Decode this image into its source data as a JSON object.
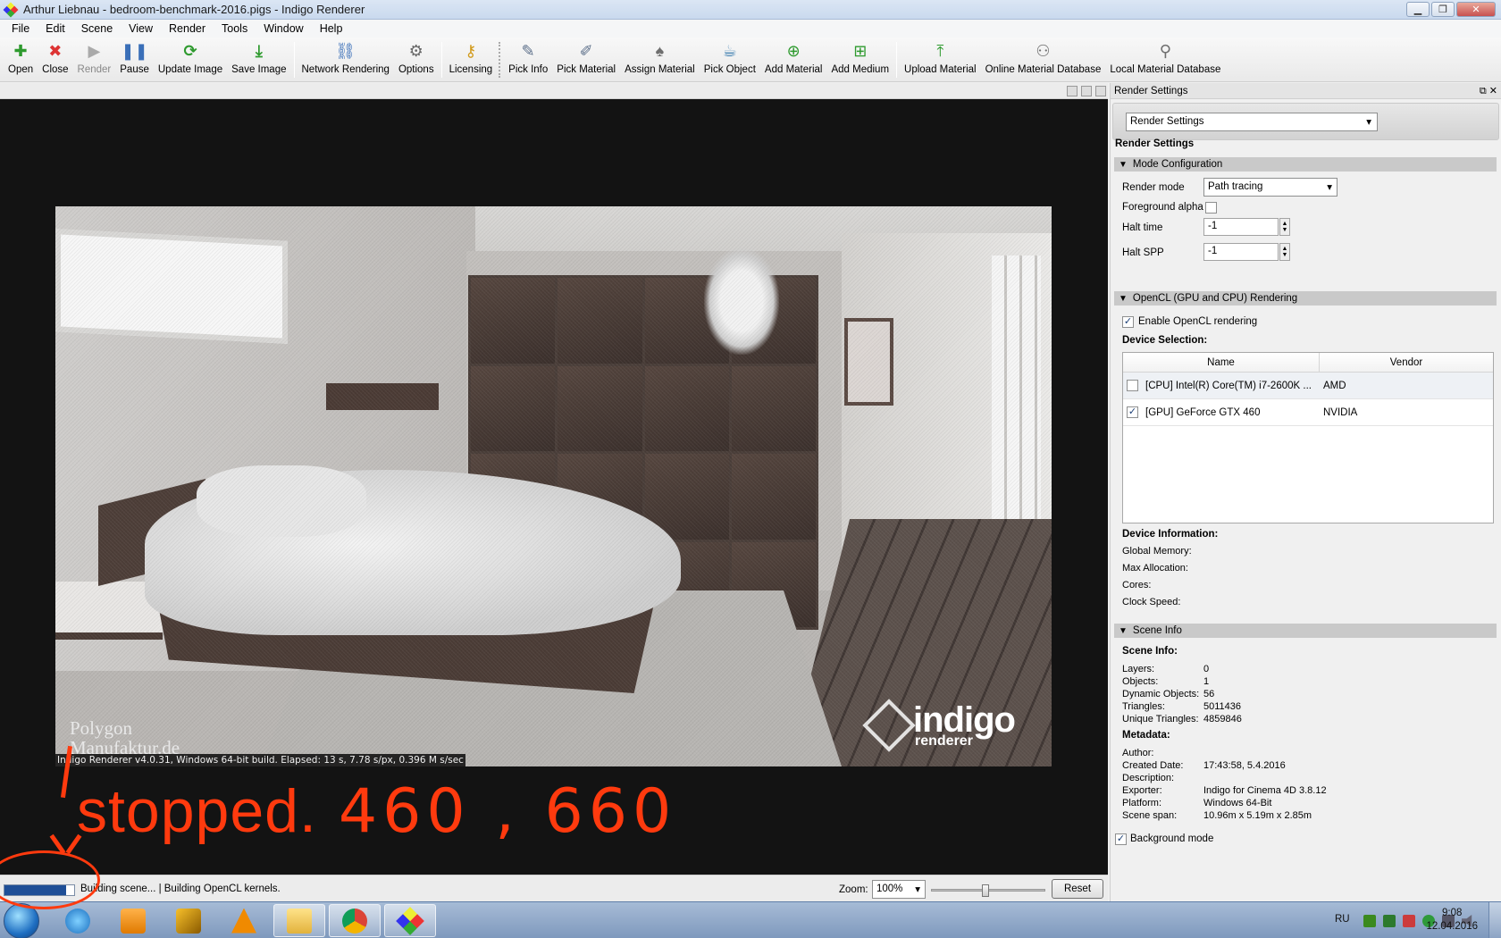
{
  "window": {
    "title": "Arthur Liebnau - bedroom-benchmark-2016.pigs - Indigo Renderer",
    "minimize": "▁",
    "maximize": "❐",
    "close": "✕"
  },
  "menu": [
    "File",
    "Edit",
    "Scene",
    "View",
    "Render",
    "Tools",
    "Window",
    "Help"
  ],
  "toolbar": {
    "open": "Open",
    "close": "Close",
    "render": "Render",
    "pause": "Pause",
    "update_image": "Update Image",
    "save_image": "Save Image",
    "network_rendering": "Network Rendering",
    "options": "Options",
    "licensing": "Licensing",
    "pick_info": "Pick Info",
    "pick_material": "Pick Material",
    "assign_material": "Assign Material",
    "pick_object": "Pick Object",
    "add_material": "Add Material",
    "add_medium": "Add Medium",
    "upload_material": "Upload Material",
    "online_material_database": "Online Material Database",
    "local_material_database": "Local Material Database"
  },
  "render": {
    "watermark_line1": "Polygon",
    "watermark_line2": "Manufaktur.de",
    "logo_big": "indigo",
    "logo_small": "renderer",
    "info": "Indigo Renderer v4.0.31, Windows 64-bit build. Elapsed: 13 s, 7.78 s/px, 0.396 M s/sec"
  },
  "annotation": {
    "text": "stopped.",
    "numbers": "460 , 660",
    "color": "#ff3a0e"
  },
  "status": {
    "progress": 0.88,
    "text": "Building scene... | Building OpenCL kernels.",
    "zoom_label": "Zoom:",
    "zoom_value": "100%",
    "zoom_slider": 0.48,
    "reset": "Reset"
  },
  "panel": {
    "title": "Render Settings",
    "panel_buttons": "⧉ ✕",
    "combo_value": "Render Settings",
    "heading": "Render Settings",
    "mode_section": "Mode Configuration",
    "render_mode_label": "Render mode",
    "render_mode_value": "Path tracing",
    "foreground_alpha_label": "Foreground alpha",
    "halt_time_label": "Halt time",
    "halt_time_value": "-1",
    "halt_spp_label": "Halt SPP",
    "halt_spp_value": "-1",
    "opencl_section": "OpenCL (GPU and CPU) Rendering",
    "enable_opencl_label": "Enable OpenCL rendering",
    "device_selection_label": "Device Selection:",
    "col_name": "Name",
    "col_vendor": "Vendor",
    "devices": [
      {
        "name": "[CPU] Intel(R) Core(TM) i7-2600K ...",
        "vendor": "AMD",
        "checked": false
      },
      {
        "name": "[GPU] GeForce GTX 460",
        "vendor": "NVIDIA",
        "checked": true
      }
    ],
    "device_info_label": "Device Information:",
    "global_memory_label": "Global Memory:",
    "max_allocation_label": "Max Allocation:",
    "cores_label": "Cores:",
    "clock_speed_label": "Clock Speed:",
    "scene_section": "Scene Info",
    "scene_info_label": "Scene Info:",
    "layers_label": "Layers:",
    "layers_value": "0",
    "objects_label": "Objects:",
    "objects_value": "1",
    "dynamic_objects_label": "Dynamic Objects:",
    "dynamic_objects_value": "56",
    "triangles_label": "Triangles:",
    "triangles_value": "5011436",
    "unique_triangles_label": "Unique Triangles:",
    "unique_triangles_value": "4859846",
    "metadata_label": "Metadata:",
    "author_label": "Author:",
    "created_date_label": "Created Date:",
    "created_date_value": "17:43:58, 5.4.2016",
    "description_label": "Description:",
    "exporter_label": "Exporter:",
    "exporter_value": "Indigo for Cinema 4D 3.8.12",
    "platform_label": "Platform:",
    "platform_value": "Windows 64-Bit",
    "scene_span_label": "Scene span:",
    "scene_span_value": "10.96m x 5.19m x 2.85m",
    "background_mode_label": "Background mode"
  },
  "taskbar": {
    "language": "RU",
    "time": "9:08",
    "date": "12.04.2016"
  }
}
